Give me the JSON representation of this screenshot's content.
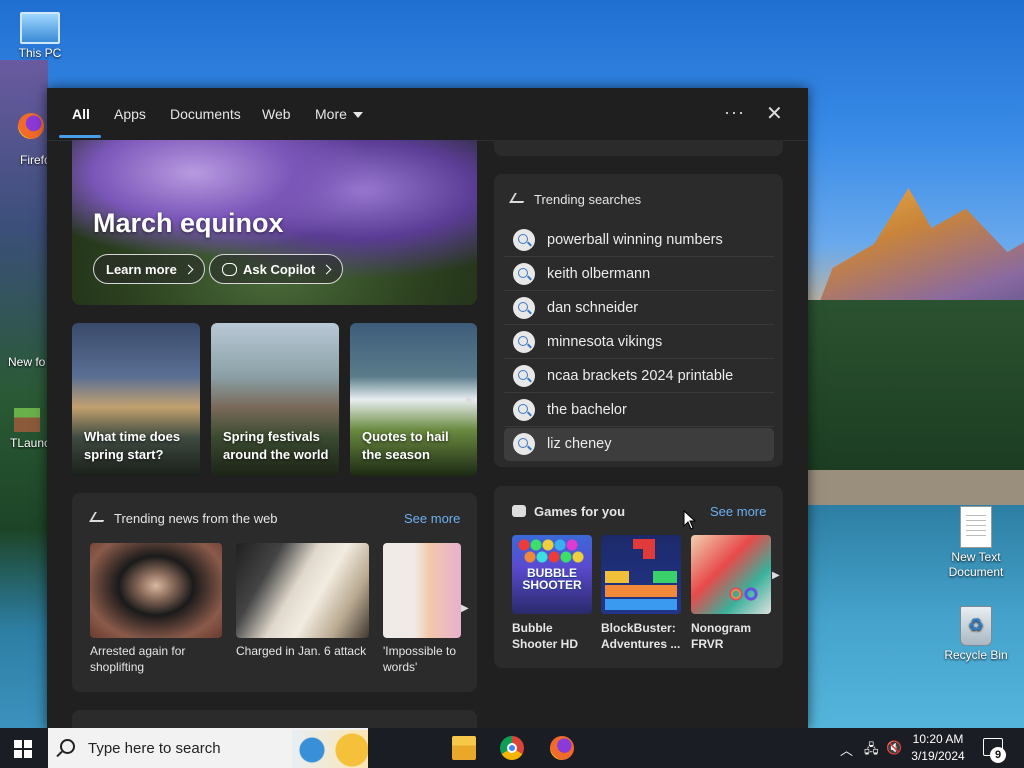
{
  "desktop": {
    "icons": {
      "this_pc": "This PC",
      "firefox": "Firefo",
      "new_folder": "New fo",
      "tlauncher": "TLaunc",
      "new_text_doc": "New Text Document",
      "recycle_bin": "Recycle Bin"
    }
  },
  "search": {
    "tabs": [
      "All",
      "Apps",
      "Documents",
      "Web",
      "More"
    ],
    "active_tab": "All",
    "more_icon": "caret-down-icon",
    "options_label": "···",
    "close_icon": "close-icon",
    "hero": {
      "title": "March equinox",
      "learn_more": "Learn more",
      "ask_copilot": "Ask Copilot"
    },
    "cards": [
      {
        "caption": "What time does spring start?"
      },
      {
        "caption": "Spring festivals around the world"
      },
      {
        "caption": "Quotes to hail the season"
      }
    ],
    "trending_news": {
      "heading": "Trending news from the web",
      "see_more": "See more",
      "items": [
        {
          "caption": "Arrested again for shoplifting"
        },
        {
          "caption": "Charged in Jan. 6 attack"
        },
        {
          "caption": "'Impossible to words'"
        }
      ]
    },
    "trending_searches": {
      "heading": "Trending searches",
      "items": [
        "powerball winning numbers",
        "keith olbermann",
        "dan schneider",
        "minnesota vikings",
        "ncaa brackets 2024 printable",
        "the bachelor",
        "liz cheney"
      ],
      "selected_index": 6
    },
    "games": {
      "heading": "Games for you",
      "see_more": "See more",
      "items": [
        {
          "title": "Bubble Shooter HD",
          "tile_text": "BUBBLE SHOOTER"
        },
        {
          "title": "BlockBuster: Adventures ..."
        },
        {
          "title": "Nonogram FRVR"
        }
      ]
    }
  },
  "taskbar": {
    "search_placeholder": "Type here to search",
    "pinned": [
      "file-explorer-icon",
      "chrome-icon",
      "firefox-icon"
    ],
    "time": "10:20 AM",
    "date": "3/19/2024",
    "notification_count": "9"
  },
  "colors": {
    "panel_bg": "#202020",
    "card_bg": "#2b2b2b",
    "accent": "#4a9ee8",
    "link": "#6cb0f0"
  }
}
